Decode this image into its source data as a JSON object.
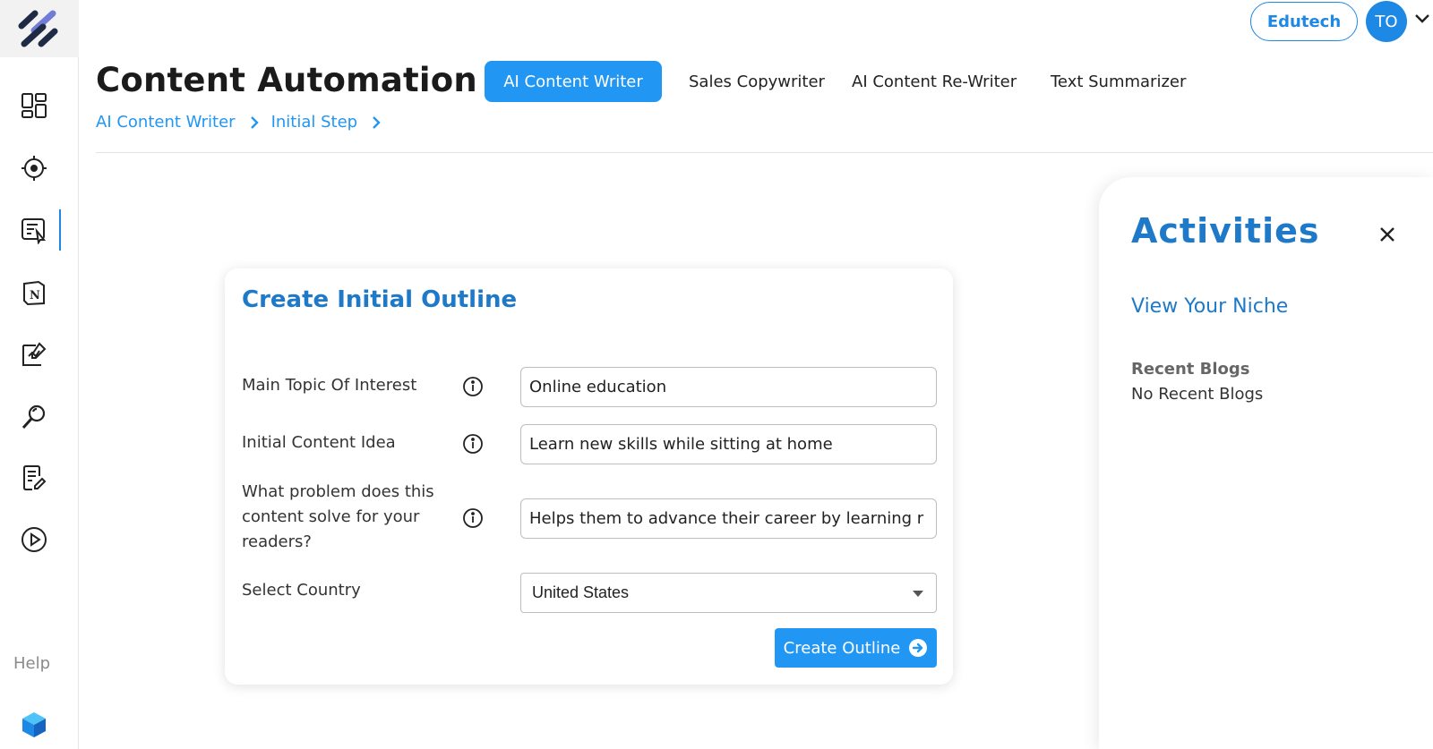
{
  "app": {
    "page_title": "Content Automation",
    "help_label": "Help"
  },
  "top_bar": {
    "brand_label": "Edutech",
    "avatar_initials": "TO"
  },
  "tabs": [
    {
      "label": "AI Content Writer",
      "active": true
    },
    {
      "label": "Sales Copywriter",
      "active": false
    },
    {
      "label": "AI Content Re-Writer",
      "active": false
    },
    {
      "label": "Text Summarizer",
      "active": false
    }
  ],
  "breadcrumb": [
    {
      "label": "AI Content Writer"
    },
    {
      "label": "Initial Step"
    }
  ],
  "sidebar": {
    "items": [
      {
        "icon": "dashboard-icon"
      },
      {
        "icon": "target-icon"
      },
      {
        "icon": "content-writer-icon",
        "active": true
      },
      {
        "icon": "notion-icon"
      },
      {
        "icon": "canvas-edit-icon"
      },
      {
        "icon": "search-icon"
      },
      {
        "icon": "document-edit-icon"
      },
      {
        "icon": "play-icon"
      }
    ]
  },
  "form": {
    "title": "Create Initial Outline",
    "fields": [
      {
        "label": "Main Topic Of Interest",
        "value": "Online education"
      },
      {
        "label": "Initial Content Idea",
        "value": "Learn new skills while sitting at home"
      },
      {
        "label": "What problem does this content solve for your readers?",
        "value": "Helps them to advance their career by learning r"
      }
    ],
    "country": {
      "label": "Select Country",
      "selected": "United States"
    },
    "submit_label": "Create Outline"
  },
  "activities": {
    "title": "Activities",
    "niche_link": "View Your Niche",
    "recent_heading": "Recent Blogs",
    "recent_empty": "No Recent Blogs"
  },
  "colors": {
    "accent": "#2196f3",
    "title_blue": "#1e7ac8",
    "logo_dark": "#1f2a44",
    "logo_light": "#6f7dd8"
  }
}
